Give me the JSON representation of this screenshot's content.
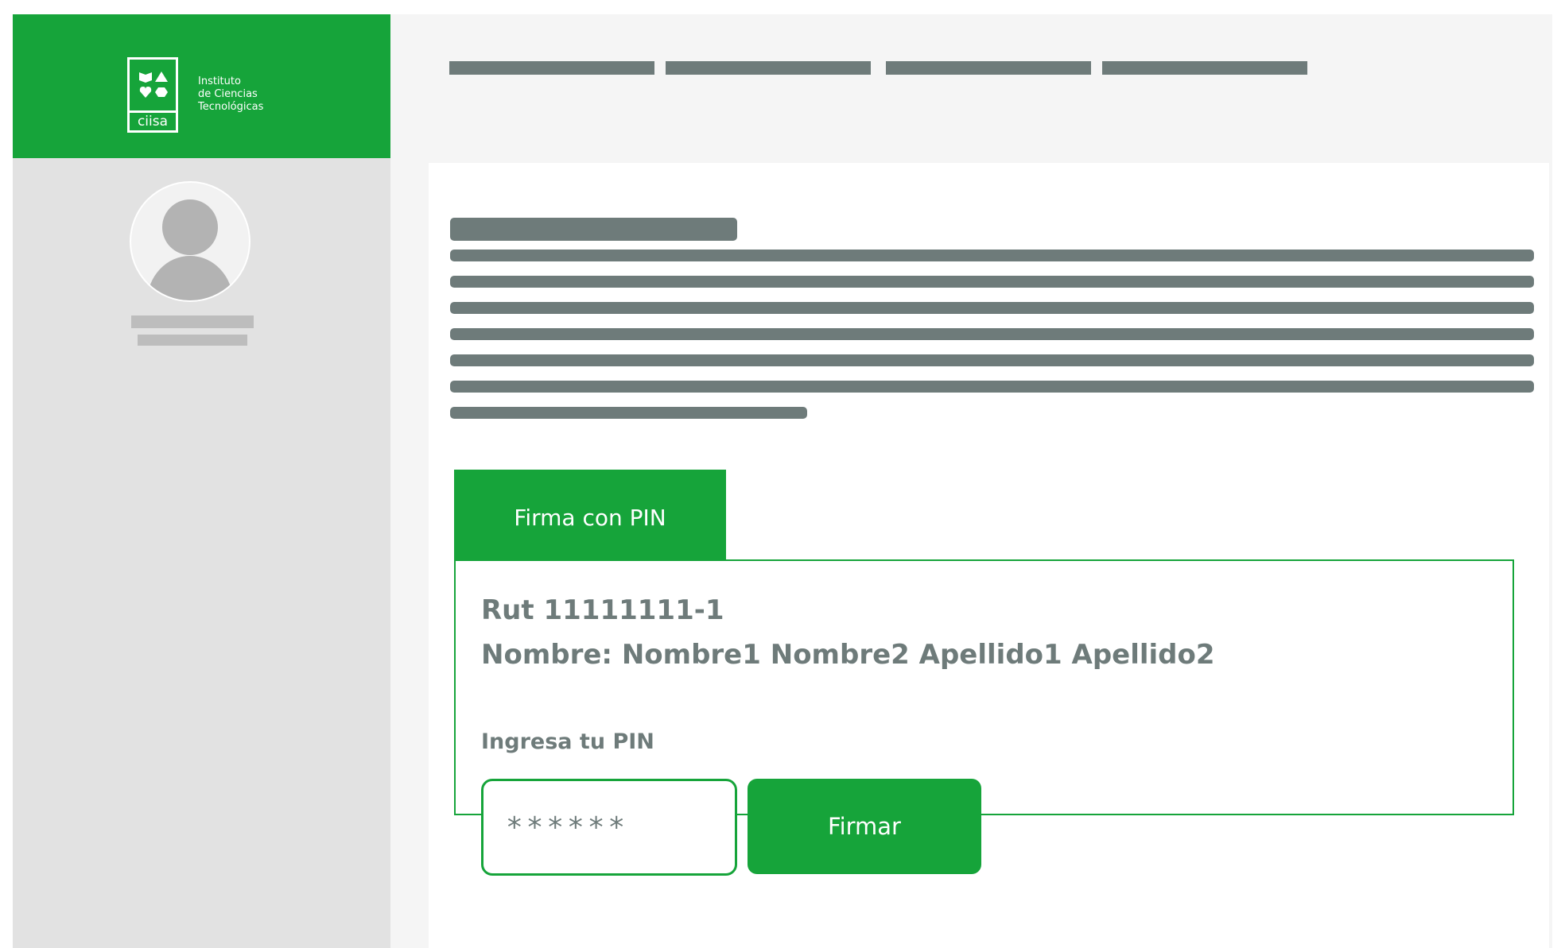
{
  "brand": {
    "logo_text": "ciisa",
    "institute_lines": [
      "Instituto",
      "de Ciencias",
      "Tecnológicas"
    ]
  },
  "sign": {
    "tab_label": "Firma con PIN",
    "rut_text": "Rut 11111111-1",
    "nombre_text": "Nombre: Nombre1 Nombre2 Apellido1 Apellido2",
    "pin_label": "Ingresa tu PIN",
    "pin_value": "******",
    "button_label": "Firmar"
  },
  "colors": {
    "brand_green": "#16a43a",
    "placeholder_gray": "#6e7b7a",
    "sidebar_gray": "#e2e2e2",
    "page_bg": "#f5f5f5"
  }
}
